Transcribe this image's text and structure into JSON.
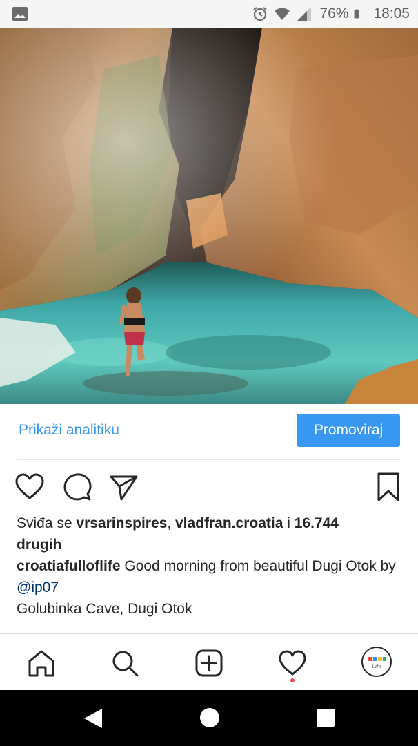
{
  "status_bar": {
    "battery_percent": "76%",
    "time": "18:05",
    "icons": [
      "gallery-icon",
      "alarm-icon",
      "wifi-icon",
      "signal-icon",
      "battery-icon"
    ]
  },
  "post": {
    "photo_icon": "cave-photo",
    "view_insights_label": "Prikaži analitiku",
    "promote_label": "Promoviraj",
    "likes": {
      "prefix": "Sviđa se ",
      "user1": "vrsarinspires",
      "sep": ", ",
      "user2": "vladfran.croatia",
      "mid": " i ",
      "count": "16.744",
      "suffix_bold": "drugih"
    },
    "caption": {
      "username": "croatiafulloflife",
      "text": " Good morning from beautiful Dugi Otok by ",
      "mention": "@ip07"
    },
    "location": "Golubinka Cave, Dugi Otok"
  },
  "profile_avatar_text": "FULL OF Life",
  "colors": {
    "accent": "#3897f0",
    "mention": "#003569",
    "notification": "#ed4956"
  }
}
